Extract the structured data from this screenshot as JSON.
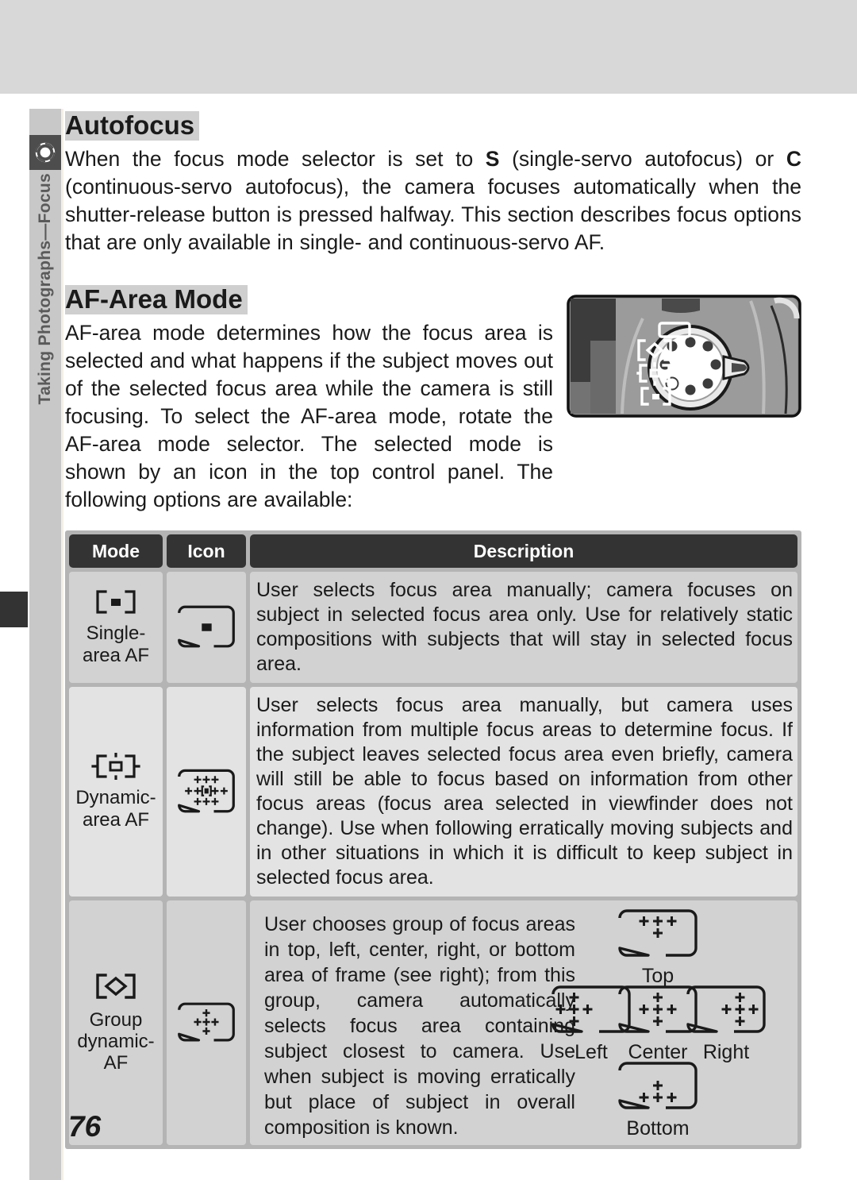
{
  "page": {
    "number": "76",
    "side_tab_label": "Taking Photographs—Focus",
    "side_tab_icon": "aperture-icon"
  },
  "sections": {
    "autofocus": {
      "heading": "Autofocus",
      "paragraph_pre": "When the focus mode selector is set to ",
      "bold_s": "S",
      "paragraph_mid": " (single-servo autofocus) or ",
      "bold_c": "C",
      "paragraph_post": " (continuous-servo autofocus), the camera focuses automatically when the shutter-release button is pressed halfway.  This section describes focus options that are only available in single- and continuous-servo AF."
    },
    "af_area_mode": {
      "heading": "AF-Area Mode",
      "paragraph": "AF-area mode determines how the focus area is selected and what happens if the subject moves out of the selected focus area while the camera is still focusing.  To select the AF-area mode, rotate the AF-area mode selector.  The selected mode is shown by an icon in the top control panel.  The following options are available:",
      "figure_caption": "camera-top-af-area-mode-selector"
    }
  },
  "table": {
    "headers": [
      "Mode",
      "Icon",
      "Description"
    ],
    "rows": [
      {
        "mode_label": "Single-\narea AF",
        "mode_line1": "Single-",
        "mode_line2": "area AF",
        "mode_glyph": "single-area-af-icon",
        "icon_glyph": "viewfinder-single-point-icon",
        "description": "User selects focus area manually; camera focuses on subject in selected focus area only.  Use for relatively static compositions with subjects that will stay in selected focus area."
      },
      {
        "mode_line1": "Dynamic-",
        "mode_line2": "area AF",
        "mode_glyph": "dynamic-area-af-icon",
        "icon_glyph": "viewfinder-dynamic-grid-icon",
        "description": "User selects focus area manually, but camera uses information from multiple focus areas to determine focus.  If the subject leaves selected focus area even briefly, camera will still be able to focus based on information from other focus areas (focus area selected in viewfinder does not change).  Use when following erratically moving subjects and in other situations in which it is difficult to keep subject in selected focus area."
      },
      {
        "mode_line1": "Group",
        "mode_line2": "dynamic-",
        "mode_line3": "AF",
        "mode_glyph": "group-dynamic-af-icon",
        "icon_glyph": "viewfinder-group-center-icon",
        "description": "User chooses group of focus areas in top, left, center, right, or bottom area of frame (see right); from this group, camera automatically selects focus area containing subject closest to camera.  Use when subject is moving erratically but place of subject in overall composition is known."
      }
    ]
  },
  "group_diagrams": [
    {
      "name": "top-group-diagram",
      "label": "Top"
    },
    {
      "name": "left-group-diagram",
      "label": "Left"
    },
    {
      "name": "center-group-diagram",
      "label": "Center"
    },
    {
      "name": "right-group-diagram",
      "label": "Right"
    },
    {
      "name": "bottom-group-diagram",
      "label": "Bottom"
    }
  ],
  "colors": {
    "page_background": "#ffffff",
    "top_band": "#d8d8d8",
    "side_tab": "#c8c8c8",
    "side_tab_icon_bg": "#4d4d4d",
    "edge_marker": "#333333",
    "table_frame": "#b4b4b4",
    "table_header": "#333333",
    "table_cell": "#d2d2d2",
    "table_cell_alt": "#e3e3e3",
    "heading_highlight": "#cfcfcf",
    "text": "#1a1a1a"
  }
}
